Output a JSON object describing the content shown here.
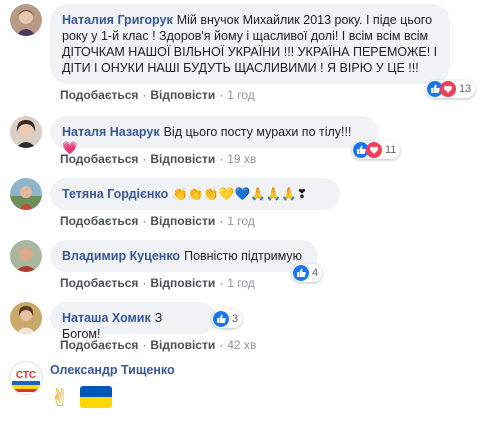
{
  "comments": [
    {
      "author": "Наталия Григорук",
      "text": "Мій внучок Михайлик 2013 року. І піде цього року у 1-й клас ! Здоров'я йому і щасливої долі! І всім всім всім ДІТОЧКАМ НАШОЇ ВІЛЬНОЇ УКРАЇНИ !!! УКРАЇНА ПЕРЕМОЖЕ! І ДІТИ І ОНУКИ НАШІ БУДУТЬ ЩАСЛИВИМИ ! Я ВІРЮ У ЦЕ !!!",
      "like_label": "Подобається",
      "reply_label": "Відповісти",
      "time": "1 год",
      "reactions": {
        "icons": [
          "like-icon",
          "love-icon"
        ],
        "count": "13"
      }
    },
    {
      "author": "Наталя Назарук",
      "text": "Від цього посту мурахи по тілу!!!💗",
      "like_label": "Подобається",
      "reply_label": "Відповісти",
      "time": "19 хв",
      "reactions": {
        "icons": [
          "like-icon",
          "love-icon"
        ],
        "count": "11"
      }
    },
    {
      "author": "Тетяна Гордієнко",
      "text": "👏👏👏💛💙🙏🙏🙏❣",
      "like_label": "Подобається",
      "reply_label": "Відповісти",
      "time": "1 год"
    },
    {
      "author": "Владимир Куценко",
      "text": "Повністю підтримую",
      "like_label": "Подобається",
      "reply_label": "Відповісти",
      "time": "1 год",
      "reactions": {
        "icons": [
          "like-icon"
        ],
        "count": "4"
      }
    },
    {
      "author": "Наташа Хомик",
      "text": "З Богом!",
      "like_label": "Подобається",
      "reply_label": "Відповісти",
      "time": "42 хв",
      "reactions": {
        "icons": [
          "like-icon"
        ],
        "count": "3"
      }
    },
    {
      "author": "Олександр Тищенко",
      "text": "✌",
      "sticker": "ukraine-flag-icon"
    }
  ],
  "colors": {
    "link": "#385898",
    "bubble": "#f0f2f5",
    "like": "#1877f2",
    "love": "#f33e58",
    "flag_blue": "#0057b7",
    "flag_yellow": "#ffd700"
  },
  "avatar_labels": {
    "c6": "СТС"
  }
}
